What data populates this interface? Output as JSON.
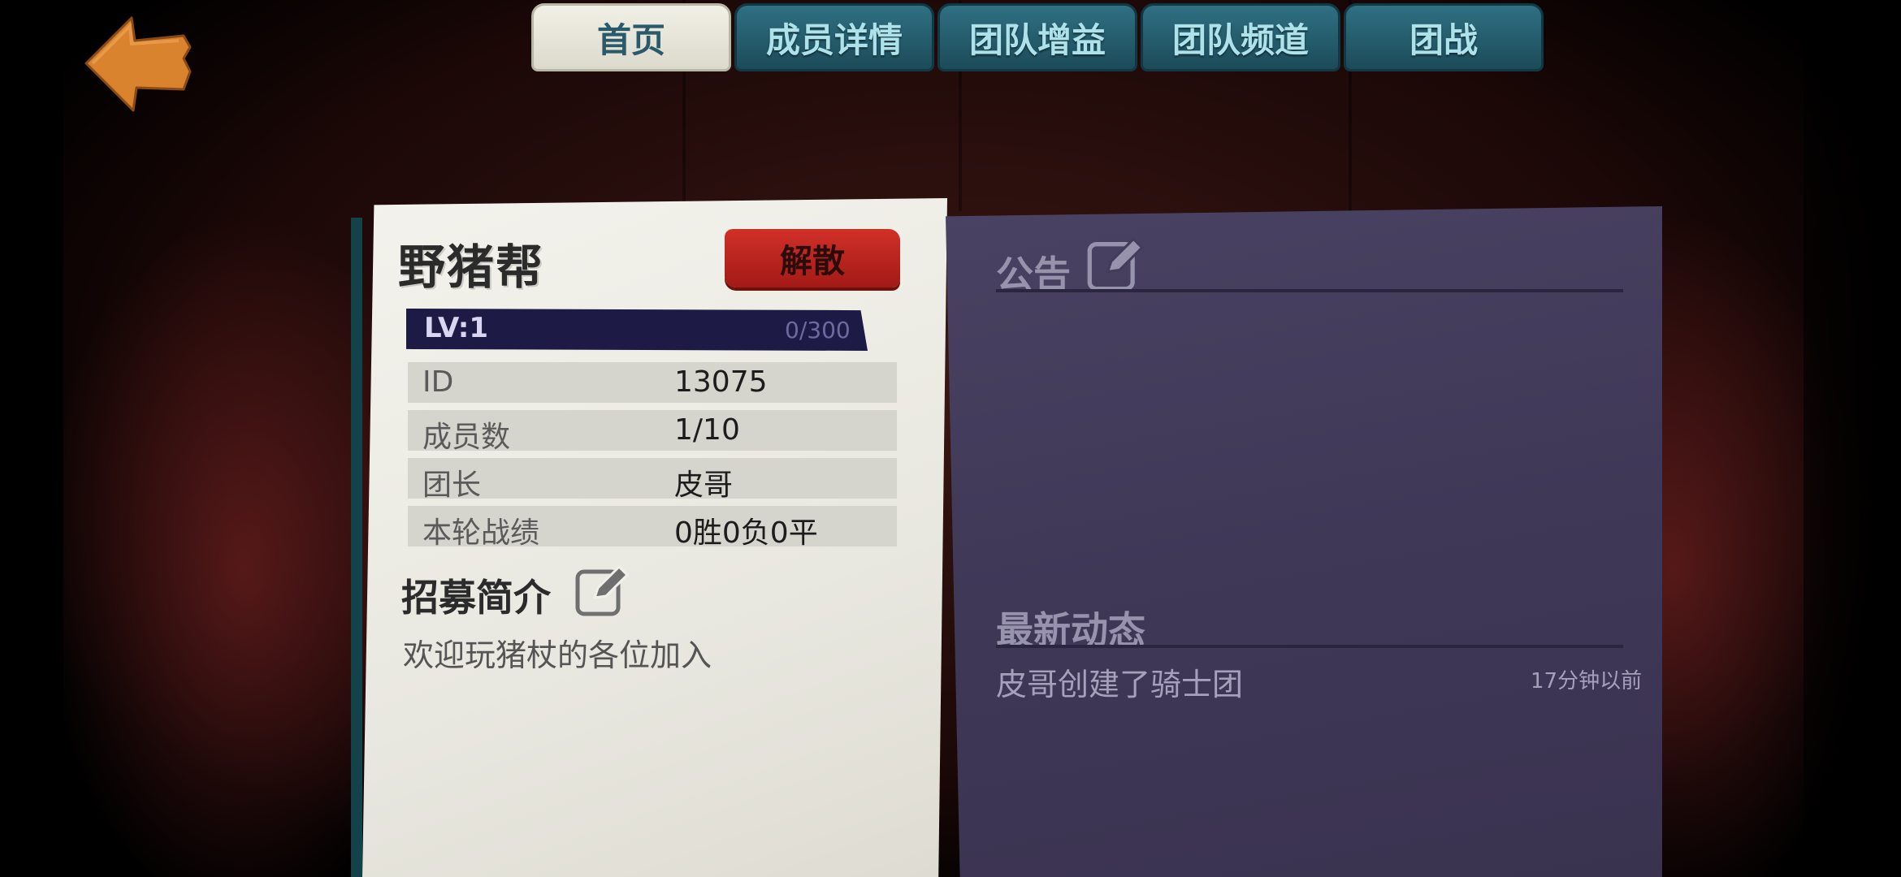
{
  "tabs": [
    {
      "label": "首页",
      "active": true
    },
    {
      "label": "成员详情",
      "active": false
    },
    {
      "label": "团队增益",
      "active": false
    },
    {
      "label": "团队频道",
      "active": false
    },
    {
      "label": "团战",
      "active": false
    }
  ],
  "team": {
    "name": "野猪帮",
    "disband_label": "解散",
    "level_label": "LV:1",
    "level_progress": "0/300",
    "level_fraction": 0.0,
    "rows": [
      {
        "key": "ID",
        "value": "13075"
      },
      {
        "key": "成员数",
        "value": "1/10"
      },
      {
        "key": "团长",
        "value": "皮哥"
      },
      {
        "key": "本轮战绩",
        "value": "0胜0负0平"
      }
    ],
    "recruit_title": "招募简介",
    "recruit_text": "欢迎玩猪杖的各位加入"
  },
  "notice": {
    "title": "公告"
  },
  "news": {
    "title": "最新动态",
    "items": [
      {
        "text": "皮哥创建了骑士团",
        "time": "17分钟以前"
      }
    ]
  },
  "icons": {
    "back": "back-arrow-icon",
    "edit": "edit-pencil-icon"
  },
  "colors": {
    "back_arrow": "#d9832e",
    "tab_inactive": "#2f7083",
    "tab_active": "#f1f0e6",
    "disband": "#c42a22",
    "level_bar": "#1d1a46",
    "notice_panel": "#433c5c"
  }
}
